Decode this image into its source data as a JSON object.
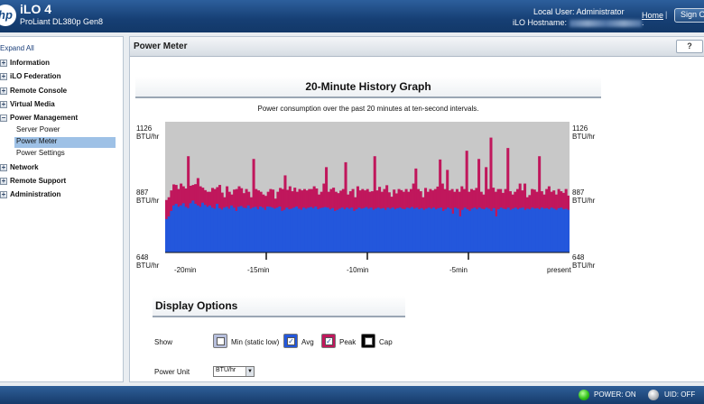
{
  "header": {
    "logo_text": "hp",
    "product": "iLO 4",
    "server_model": "ProLiant DL380p Gen8",
    "user_label": "Local User:",
    "user_name": "Administrator",
    "hostname_label": "iLO Hostname:",
    "hostname_tail": ".",
    "home_link": "Home",
    "separator": "|",
    "sign_out": "Sign Out"
  },
  "sidebar": {
    "expand_all": "Expand All",
    "sections": [
      {
        "label": "Information",
        "toggle": "+"
      },
      {
        "label": "iLO Federation",
        "toggle": "+"
      },
      {
        "label": "Remote Console",
        "toggle": "+"
      },
      {
        "label": "Virtual Media",
        "toggle": "+"
      },
      {
        "label": "Power Management",
        "toggle": "−"
      },
      {
        "label": "Network",
        "toggle": "+"
      },
      {
        "label": "Remote Support",
        "toggle": "+"
      },
      {
        "label": "Administration",
        "toggle": "+"
      }
    ],
    "power_items": [
      {
        "label": "Server Power",
        "selected": false
      },
      {
        "label": "Power Meter",
        "selected": true
      },
      {
        "label": "Power Settings",
        "selected": false
      }
    ]
  },
  "page": {
    "title": "Power Meter",
    "help_label": "?"
  },
  "graph": {
    "title": "20-Minute History Graph",
    "caption": "Power consumption over the past 20 minutes at ten-second intervals.",
    "y_unit": "BTU/hr",
    "y_ticks": [
      "1126",
      "887",
      "648"
    ],
    "x_ticks": [
      "-20min",
      "-15min",
      "-10min",
      "-5min",
      "present"
    ],
    "colors": {
      "background": "#c8c8c8",
      "peak": "#c0175c",
      "avg": "#2357dc",
      "axis": "#111111"
    }
  },
  "chart_data": {
    "type": "bar",
    "title": "20-Minute History Graph",
    "ylabel": "BTU/hr",
    "ylim": [
      648,
      1126
    ],
    "x_ticks": [
      "-20min",
      "-15min",
      "-10min",
      "-5min",
      "present"
    ],
    "series": [
      {
        "name": "Peak",
        "values": [
          840,
          850,
          875,
          897,
          895,
          880,
          900,
          890,
          882,
          1000,
          892,
          895,
          898,
          920,
          890,
          885,
          876,
          870,
          870,
          884,
          880,
          887,
          895,
          867,
          850,
          890,
          870,
          860,
          878,
          880,
          890,
          883,
          865,
          880,
          870,
          850,
          990,
          880,
          875,
          870,
          860,
          855,
          870,
          880,
          878,
          845,
          870,
          884,
          880,
          930,
          877,
          890,
          872,
          885,
          870,
          880,
          875,
          880,
          875,
          880,
          880,
          890,
          882,
          860,
          870,
          900,
          960,
          870,
          880,
          885,
          870,
          865,
          874,
          880,
          978,
          860,
          872,
          880,
          850,
          890,
          875,
          880,
          875,
          880,
          870,
          872,
          1000,
          875,
          888,
          870,
          880,
          894,
          868,
          852,
          878,
          864,
          880,
          876,
          870,
          880,
          870,
          880,
          900,
          955,
          880,
          872,
          850,
          884,
          870,
          880,
          875,
          880,
          889,
          988,
          900,
          880,
          950,
          875,
          880,
          870,
          880,
          870,
          890,
          880,
          1020,
          870,
          880,
          876,
          884,
          990,
          870,
          860,
          960,
          880,
          1068,
          885,
          870,
          880,
          880,
          866,
          880,
          1030,
          872,
          860,
          870,
          880,
          900,
          875,
          900,
          850,
          858,
          880,
          878,
          870,
          1000,
          872,
          860,
          880,
          890,
          870,
          875,
          860,
          880,
          872,
          866,
          880,
          856
        ]
      },
      {
        "name": "Avg",
        "values": [
          770,
          780,
          800,
          820,
          826,
          815,
          820,
          828,
          815,
          810,
          828,
          838,
          826,
          820,
          815,
          830,
          822,
          815,
          820,
          812,
          808,
          826,
          810,
          805,
          812,
          815,
          808,
          820,
          812,
          800,
          815,
          818,
          812,
          810,
          820,
          808,
          812,
          815,
          806,
          816,
          812,
          804,
          816,
          815,
          812,
          808,
          812,
          816,
          800,
          804,
          812,
          806,
          808,
          812,
          816,
          808,
          804,
          812,
          808,
          812,
          814,
          810,
          816,
          806,
          810,
          812,
          814,
          812,
          806,
          810,
          800,
          804,
          808,
          812,
          806,
          812,
          808,
          812,
          800,
          806,
          812,
          808,
          810,
          814,
          808,
          812,
          804,
          808,
          812,
          808,
          810,
          804,
          812,
          808,
          812,
          806,
          810,
          812,
          808,
          806,
          812,
          810,
          814,
          808,
          812,
          806,
          810,
          804,
          808,
          812,
          808,
          812,
          806,
          810,
          812,
          800,
          806,
          812,
          808,
          790,
          812,
          808,
          780,
          804,
          812,
          806,
          800,
          808,
          812,
          806,
          812,
          808,
          806,
          812,
          808,
          800,
          810,
          780,
          806,
          812,
          808,
          806,
          812,
          804,
          808,
          812,
          806,
          810,
          812,
          804,
          808,
          806,
          812,
          808,
          810,
          806,
          812,
          808,
          810,
          806,
          812,
          808,
          804,
          810,
          812,
          806,
          808,
          804
        ]
      }
    ]
  },
  "options": {
    "title": "Display Options",
    "show_label": "Show",
    "items": [
      {
        "label": "Min (static low)",
        "checked": false,
        "color": "#b7bfdc"
      },
      {
        "label": "Avg",
        "checked": true,
        "color": "#2357dc"
      },
      {
        "label": "Peak",
        "checked": true,
        "color": "#c0175c"
      },
      {
        "label": "Cap",
        "checked": false,
        "color": "#000000"
      }
    ],
    "power_unit_label": "Power Unit",
    "power_unit_value": "BTU/hr"
  },
  "footer": {
    "power_status": "POWER: ON",
    "uid_status": "UID: OFF"
  }
}
